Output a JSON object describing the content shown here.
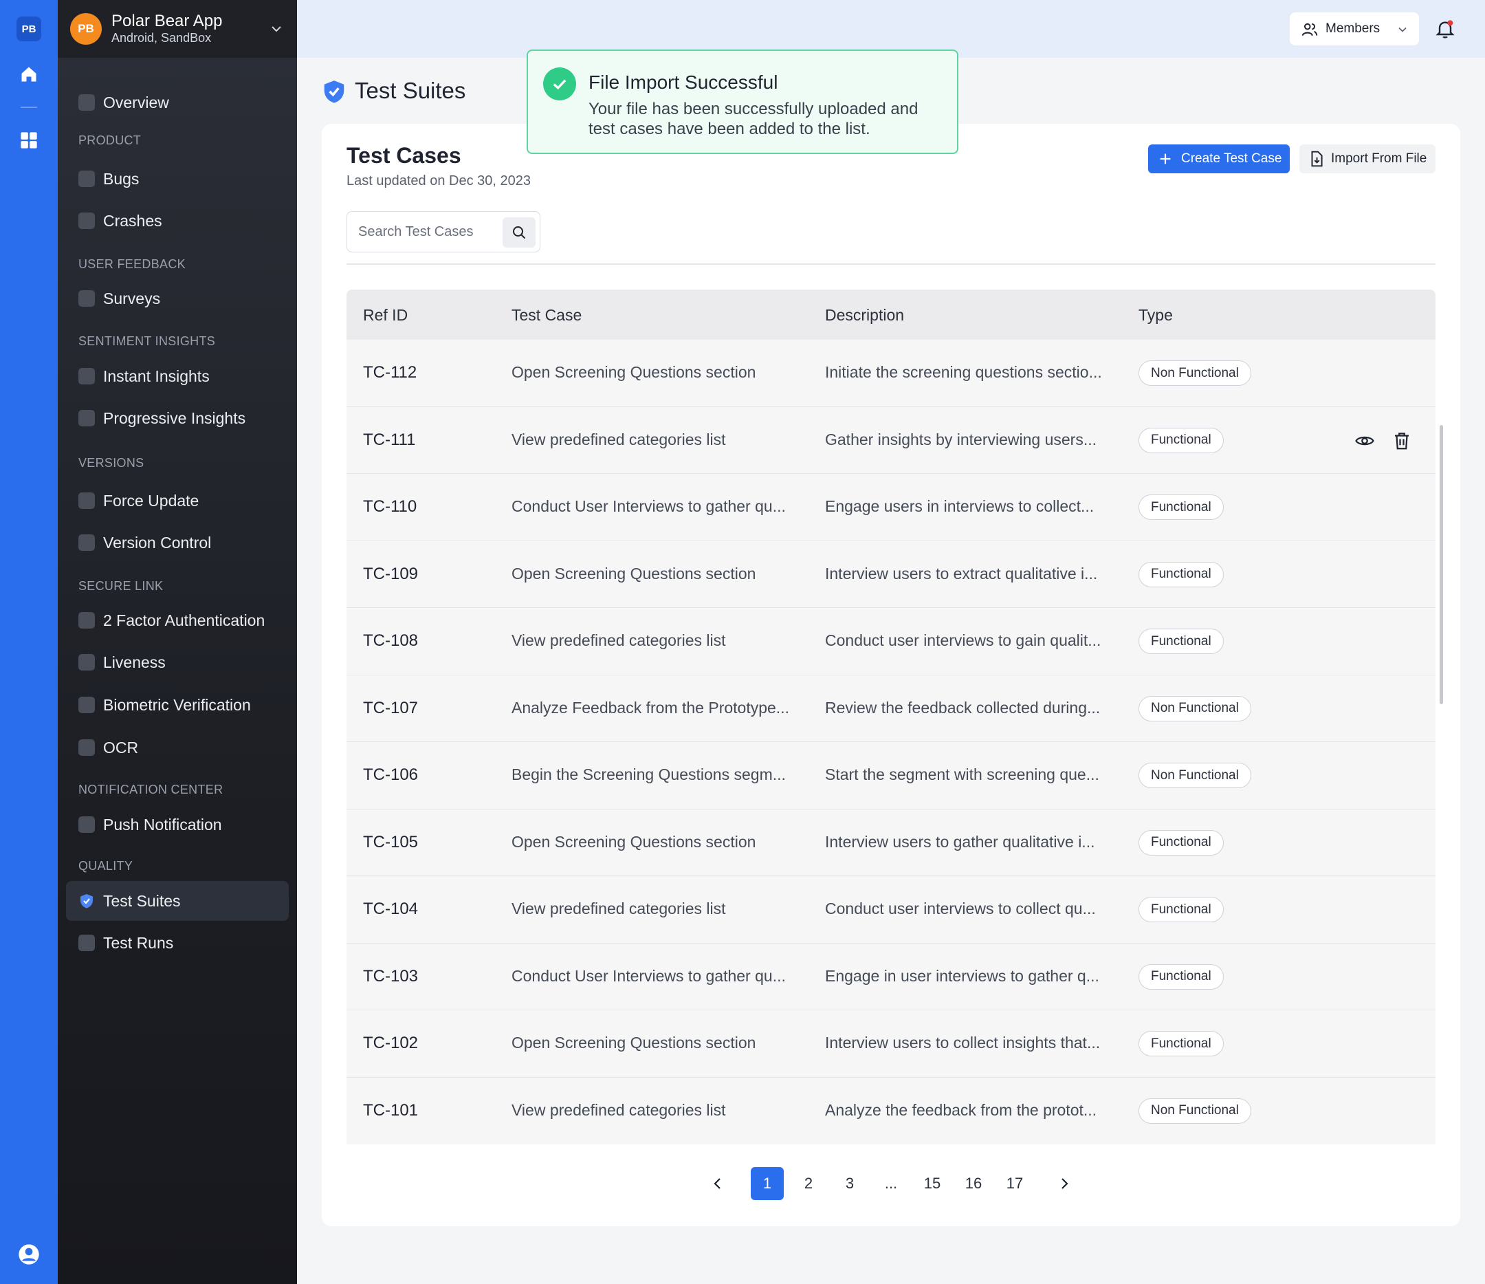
{
  "rail": {
    "badge": "PB"
  },
  "app": {
    "initials": "PB",
    "name": "Polar Bear App",
    "platform": "Android, SandBox"
  },
  "sidebar": {
    "overview": "Overview",
    "sections": {
      "product": "PRODUCT",
      "user_feedback": "USER FEEDBACK",
      "sentiment": "SENTIMENT INSIGHTS",
      "versions": "VERSIONS",
      "secure_link": "SECURE LINK",
      "notification": "NOTIFICATION CENTER",
      "quality": "QUALITY"
    },
    "items": {
      "bugs": "Bugs",
      "crashes": "Crashes",
      "surveys": "Surveys",
      "instant_insights": "Instant Insights",
      "progressive_insights": "Progressive Insights",
      "force_update": "Force Update",
      "version_control": "Version Control",
      "two_factor": "2 Factor Authentication",
      "liveness": "Liveness",
      "biometric": "Biometric Verification",
      "ocr": "OCR",
      "push_notification": "Push Notification",
      "test_suites": "Test Suites",
      "test_runs": "Test Runs"
    }
  },
  "topbar": {
    "members_label": "Members"
  },
  "page": {
    "title": "Test Suites"
  },
  "card": {
    "title": "Test Cases",
    "subtitle": "Last updated on Dec 30, 2023",
    "create_label": "Create Test Case",
    "import_label": "Import From File",
    "search_placeholder": "Search Test Cases"
  },
  "table": {
    "headers": {
      "ref": "Ref ID",
      "case": "Test Case",
      "desc": "Description",
      "type": "Type"
    },
    "rows": [
      {
        "ref": "TC-112",
        "case": "Open Screening Questions section",
        "desc": "Initiate the screening questions sectio...",
        "type": "Non Functional"
      },
      {
        "ref": "TC-111",
        "case": "View predefined categories list",
        "desc": "Gather insights by interviewing users...",
        "type": "Functional"
      },
      {
        "ref": "TC-110",
        "case": "Conduct User Interviews to gather qu...",
        "desc": "Engage users in interviews to collect...",
        "type": "Functional"
      },
      {
        "ref": "TC-109",
        "case": "Open Screening Questions section",
        "desc": "Interview users to extract qualitative i...",
        "type": "Functional"
      },
      {
        "ref": "TC-108",
        "case": "View predefined categories list",
        "desc": "Conduct user interviews to gain qualit...",
        "type": "Functional"
      },
      {
        "ref": "TC-107",
        "case": "Analyze Feedback from the Prototype...",
        "desc": "Review the feedback collected during...",
        "type": "Non Functional"
      },
      {
        "ref": "TC-106",
        "case": "Begin the Screening Questions segm...",
        "desc": "Start the segment with screening que...",
        "type": "Non Functional"
      },
      {
        "ref": "TC-105",
        "case": "Open Screening Questions section",
        "desc": "Interview users to gather qualitative i...",
        "type": "Functional"
      },
      {
        "ref": "TC-104",
        "case": "View predefined categories list",
        "desc": "Conduct user interviews to collect qu...",
        "type": "Functional"
      },
      {
        "ref": "TC-103",
        "case": "Conduct User Interviews to gather qu...",
        "desc": "Engage in user interviews to gather q...",
        "type": "Functional"
      },
      {
        "ref": "TC-102",
        "case": "Open Screening Questions section",
        "desc": "Interview users to collect insights that...",
        "type": "Functional"
      },
      {
        "ref": "TC-101",
        "case": "View predefined categories list",
        "desc": "Analyze the feedback from the protot...",
        "type": "Non Functional"
      }
    ]
  },
  "pagination": {
    "pages": [
      "1",
      "2",
      "3",
      "...",
      "15",
      "16",
      "17"
    ],
    "current": "1"
  },
  "toast": {
    "title": "File Import Successful",
    "message": "Your file has been successfully uploaded and test cases have been added to the list."
  },
  "colors": {
    "accent": "#2a6ded",
    "success": "#2ecc87",
    "avatar": "#f58a1f"
  }
}
